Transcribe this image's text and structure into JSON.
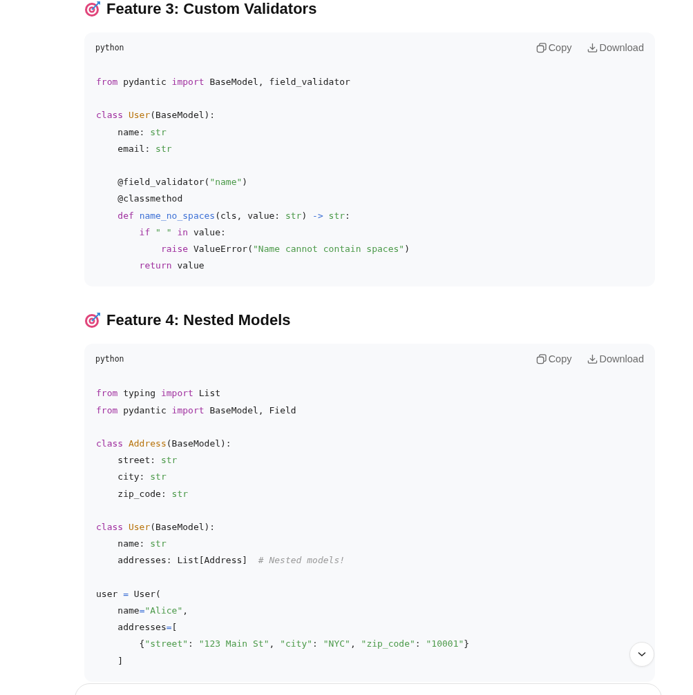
{
  "sections": [
    {
      "title": "Feature 3: Custom Validators",
      "code": {
        "language": "python",
        "actions": [
          {
            "kind": "copy",
            "label": "Copy"
          },
          {
            "kind": "download",
            "label": "Download"
          }
        ],
        "lines": [
          {
            "gap_before": false,
            "tokens": [
              {
                "kind": "keyword",
                "text": "from"
              },
              {
                "kind": "plain",
                "text": " pydantic "
              },
              {
                "kind": "keyword",
                "text": "import"
              },
              {
                "kind": "plain",
                "text": " BaseModel, field_validator"
              }
            ]
          },
          {
            "gap_before": true,
            "tokens": [
              {
                "kind": "keyword",
                "text": "class "
              },
              {
                "kind": "classname",
                "text": "User"
              },
              {
                "kind": "plain",
                "text": "(BaseModel):"
              }
            ]
          },
          {
            "gap_before": false,
            "tokens": [
              {
                "kind": "plain",
                "text": "    name: "
              },
              {
                "kind": "type",
                "text": "str"
              }
            ]
          },
          {
            "gap_before": false,
            "tokens": [
              {
                "kind": "plain",
                "text": "    email: "
              },
              {
                "kind": "type",
                "text": "str"
              }
            ]
          },
          {
            "gap_before": true,
            "tokens": [
              {
                "kind": "plain",
                "text": "    @field_validator("
              },
              {
                "kind": "string",
                "text": "\"name\""
              },
              {
                "kind": "plain",
                "text": ")"
              }
            ]
          },
          {
            "gap_before": false,
            "tokens": [
              {
                "kind": "plain",
                "text": "    @classmethod"
              }
            ]
          },
          {
            "gap_before": false,
            "tokens": [
              {
                "kind": "keyword",
                "text": "    def "
              },
              {
                "kind": "function",
                "text": "name_no_spaces"
              },
              {
                "kind": "plain",
                "text": "(cls, value: "
              },
              {
                "kind": "type",
                "text": "str"
              },
              {
                "kind": "plain",
                "text": ") "
              },
              {
                "kind": "operator",
                "text": "-> "
              },
              {
                "kind": "type",
                "text": "str"
              },
              {
                "kind": "plain",
                "text": ":"
              }
            ]
          },
          {
            "gap_before": false,
            "tokens": [
              {
                "kind": "keyword",
                "text": "        if "
              },
              {
                "kind": "string",
                "text": "\" \" "
              },
              {
                "kind": "keyword",
                "text": "in"
              },
              {
                "kind": "plain",
                "text": " value:"
              }
            ]
          },
          {
            "gap_before": false,
            "tokens": [
              {
                "kind": "keyword",
                "text": "            raise"
              },
              {
                "kind": "plain",
                "text": " ValueError("
              },
              {
                "kind": "string",
                "text": "\"Name cannot contain spaces\""
              },
              {
                "kind": "plain",
                "text": ")"
              }
            ]
          },
          {
            "gap_before": false,
            "tokens": [
              {
                "kind": "keyword",
                "text": "        return"
              },
              {
                "kind": "plain",
                "text": " value"
              }
            ]
          }
        ]
      }
    },
    {
      "title": "Feature 4: Nested Models",
      "code": {
        "language": "python",
        "actions": [
          {
            "kind": "copy",
            "label": "Copy"
          },
          {
            "kind": "download",
            "label": "Download"
          }
        ],
        "lines": [
          {
            "gap_before": false,
            "tokens": [
              {
                "kind": "keyword",
                "text": "from"
              },
              {
                "kind": "plain",
                "text": " typing "
              },
              {
                "kind": "keyword",
                "text": "import"
              },
              {
                "kind": "plain",
                "text": " List"
              }
            ]
          },
          {
            "gap_before": false,
            "tokens": [
              {
                "kind": "keyword",
                "text": "from"
              },
              {
                "kind": "plain",
                "text": " pydantic "
              },
              {
                "kind": "keyword",
                "text": "import"
              },
              {
                "kind": "plain",
                "text": " BaseModel, Field"
              }
            ]
          },
          {
            "gap_before": true,
            "tokens": [
              {
                "kind": "keyword",
                "text": "class "
              },
              {
                "kind": "classname",
                "text": "Address"
              },
              {
                "kind": "plain",
                "text": "(BaseModel):"
              }
            ]
          },
          {
            "gap_before": false,
            "tokens": [
              {
                "kind": "plain",
                "text": "    street: "
              },
              {
                "kind": "type",
                "text": "str"
              }
            ]
          },
          {
            "gap_before": false,
            "tokens": [
              {
                "kind": "plain",
                "text": "    city: "
              },
              {
                "kind": "type",
                "text": "str"
              }
            ]
          },
          {
            "gap_before": false,
            "tokens": [
              {
                "kind": "plain",
                "text": "    zip_code: "
              },
              {
                "kind": "type",
                "text": "str"
              }
            ]
          },
          {
            "gap_before": true,
            "tokens": [
              {
                "kind": "keyword",
                "text": "class "
              },
              {
                "kind": "classname",
                "text": "User"
              },
              {
                "kind": "plain",
                "text": "(BaseModel):"
              }
            ]
          },
          {
            "gap_before": false,
            "tokens": [
              {
                "kind": "plain",
                "text": "    name: "
              },
              {
                "kind": "type",
                "text": "str"
              }
            ]
          },
          {
            "gap_before": false,
            "tokens": [
              {
                "kind": "plain",
                "text": "    addresses: List[Address]  "
              },
              {
                "kind": "comment",
                "text": "# Nested models!"
              }
            ]
          },
          {
            "gap_before": true,
            "tokens": [
              {
                "kind": "plain",
                "text": "user "
              },
              {
                "kind": "operator",
                "text": "="
              },
              {
                "kind": "plain",
                "text": " User("
              }
            ]
          },
          {
            "gap_before": false,
            "tokens": [
              {
                "kind": "plain",
                "text": "    name"
              },
              {
                "kind": "operator",
                "text": "="
              },
              {
                "kind": "string",
                "text": "\"Alice\""
              },
              {
                "kind": "plain",
                "text": ","
              }
            ]
          },
          {
            "gap_before": false,
            "tokens": [
              {
                "kind": "plain",
                "text": "    addresses"
              },
              {
                "kind": "operator",
                "text": "="
              },
              {
                "kind": "plain",
                "text": "["
              }
            ]
          },
          {
            "gap_before": false,
            "tokens": [
              {
                "kind": "plain",
                "text": "        {"
              },
              {
                "kind": "string",
                "text": "\"street\""
              },
              {
                "kind": "plain",
                "text": ": "
              },
              {
                "kind": "string",
                "text": "\"123 Main St\""
              },
              {
                "kind": "plain",
                "text": ", "
              },
              {
                "kind": "string",
                "text": "\"city\""
              },
              {
                "kind": "plain",
                "text": ": "
              },
              {
                "kind": "string",
                "text": "\"NYC\""
              },
              {
                "kind": "plain",
                "text": ", "
              },
              {
                "kind": "string",
                "text": "\"zip_code\""
              },
              {
                "kind": "plain",
                "text": ": "
              },
              {
                "kind": "string",
                "text": "\"10001\""
              },
              {
                "kind": "plain",
                "text": "}"
              }
            ]
          },
          {
            "gap_before": false,
            "tokens": [
              {
                "kind": "plain",
                "text": "    ]"
              }
            ]
          }
        ]
      }
    }
  ]
}
